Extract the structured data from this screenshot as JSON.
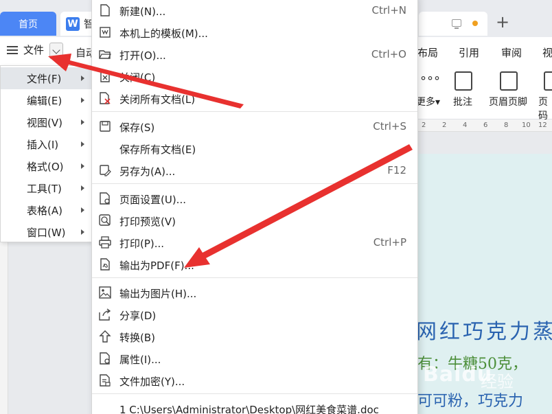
{
  "tabs": {
    "home": "首页",
    "doc": "智",
    "doc_icon": "W"
  },
  "toolbar": {
    "file_menu_label": "文件",
    "auto": "自动",
    "tabs": [
      {
        "label": "布局"
      },
      {
        "label": "引用"
      },
      {
        "label": "审阅"
      },
      {
        "label": "视"
      }
    ],
    "more_label": "更多",
    "more_dots": "°°°",
    "buttons": [
      {
        "label": "批注"
      },
      {
        "label": "页眉页脚"
      },
      {
        "label": "页码"
      }
    ]
  },
  "ruler": [
    "2",
    "2",
    "4",
    "6",
    "8",
    "10",
    "12",
    "14"
  ],
  "submenu": {
    "items": [
      {
        "label": "文件(F)",
        "active": true
      },
      {
        "label": "编辑(E)"
      },
      {
        "label": "视图(V)"
      },
      {
        "label": "插入(I)"
      },
      {
        "label": "格式(O)"
      },
      {
        "label": "工具(T)"
      },
      {
        "label": "表格(A)"
      },
      {
        "label": "窗口(W)"
      }
    ]
  },
  "file_menu": {
    "items": [
      {
        "label": "新建(N)...",
        "shortcut": "Ctrl+N",
        "icon": "new-document-icon"
      },
      {
        "label": "本机上的模板(M)...",
        "shortcut": "",
        "icon": "template-icon"
      },
      {
        "label": "打开(O)...",
        "shortcut": "Ctrl+O",
        "icon": "folder-open-icon"
      },
      {
        "label": "关闭(C)",
        "shortcut": "",
        "icon": "close-document-icon"
      },
      {
        "label": "关闭所有文档(L)",
        "shortcut": "",
        "icon": "close-all-icon"
      },
      {
        "label": "保存(S)",
        "shortcut": "Ctrl+S",
        "icon": "save-icon"
      },
      {
        "label": "保存所有文档(E)",
        "shortcut": "",
        "icon": ""
      },
      {
        "label": "另存为(A)...",
        "shortcut": "F12",
        "icon": "save-as-icon"
      },
      {
        "label": "页面设置(U)...",
        "shortcut": "",
        "icon": "page-setup-icon"
      },
      {
        "label": "打印预览(V)",
        "shortcut": "",
        "icon": "print-preview-icon"
      },
      {
        "label": "打印(P)...",
        "shortcut": "Ctrl+P",
        "icon": "printer-icon"
      },
      {
        "label": "输出为PDF(F)...",
        "shortcut": "",
        "icon": "export-pdf-icon"
      },
      {
        "label": "输出为图片(H)...",
        "shortcut": "",
        "icon": "export-image-icon"
      },
      {
        "label": "分享(D)",
        "shortcut": "",
        "icon": "share-icon"
      },
      {
        "label": "转换(B)",
        "shortcut": "",
        "icon": "convert-icon"
      },
      {
        "label": "属性(I)...",
        "shortcut": "",
        "icon": "properties-icon"
      },
      {
        "label": "文件加密(Y)...",
        "shortcut": "",
        "icon": "encrypt-icon"
      },
      {
        "label": "1 C:\\Users\\Administrator\\Desktop\\网红美食菜谱.doc",
        "shortcut": "",
        "icon": ""
      }
    ]
  },
  "document": {
    "title": "网红巧克力蒸",
    "line1": "有：牛糖50克，",
    "line2": "可可粉，巧克力"
  },
  "watermark": {
    "brand": "Baidu",
    "sub": "经验"
  },
  "colors": {
    "accent": "#4c86f5",
    "arrow": "#e8312f"
  }
}
